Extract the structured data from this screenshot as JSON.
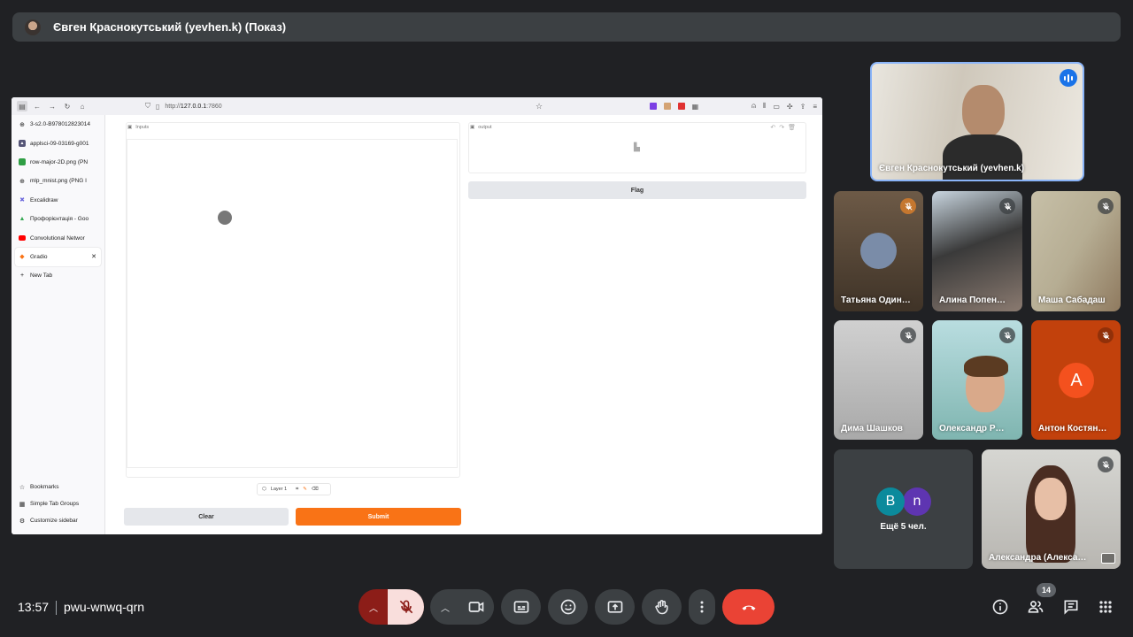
{
  "banner": {
    "title": "Євген Краснокутський (yevhen.k) (Показ)"
  },
  "browser": {
    "url_prefix": "http://",
    "url_host": "127.0.0.1",
    "url_port": ":7860",
    "tabs": [
      {
        "label": "3-s2.0-B978012823014"
      },
      {
        "label": "applsci-09-03169-g001"
      },
      {
        "label": "row-major-2D.png (PN"
      },
      {
        "label": "mlp_mnist.png (PNG I"
      },
      {
        "label": "Excalidraw"
      },
      {
        "label": "Профорієнтація - Goo"
      },
      {
        "label": "Convolutional Networ"
      },
      {
        "label": "Gradio"
      },
      {
        "label": "New Tab"
      }
    ],
    "sidebar_bottom": [
      {
        "label": "Bookmarks"
      },
      {
        "label": "Simple Tab Groups"
      },
      {
        "label": "Customize sidebar"
      }
    ]
  },
  "gradio": {
    "inputs_label": "Inputs",
    "output_label": "output",
    "layer_label": "Layer 1",
    "clear_label": "Clear",
    "submit_label": "Submit",
    "flag_label": "Flag",
    "accent": "#f97316"
  },
  "participants": {
    "presenter": "Євген Краснокутський (yevhen.k)",
    "tiles": [
      {
        "name": "Татьяна Один…"
      },
      {
        "name": "Алина Попен…"
      },
      {
        "name": "Маша Сабадаш"
      },
      {
        "name": "Дима Шашков"
      },
      {
        "name": "Олександр Р…"
      },
      {
        "name": "Антон Костян…",
        "initial": "A"
      },
      {
        "name": "Александра (Алекса…"
      }
    ],
    "more": {
      "label": "Ещё 5 чел.",
      "initials": [
        "B",
        "n"
      ]
    }
  },
  "bottom": {
    "time": "13:57",
    "meeting_code": "pwu-wnwq-qrn",
    "people_count": "14"
  }
}
